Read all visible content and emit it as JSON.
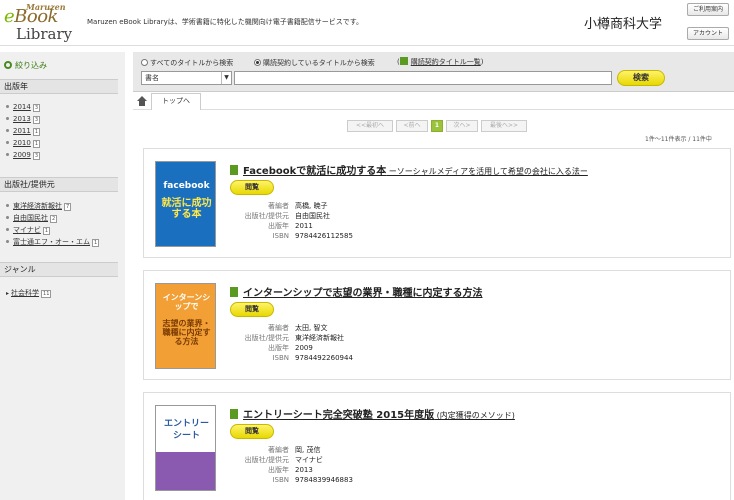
{
  "header": {
    "logo_line1": "Maruzen",
    "logo_line2_e": "e",
    "logo_line2_book": "Book",
    "logo_line3": "Library",
    "tagline": "Maruzen eBook Libraryは、学術書籍に特化した機関向け電子書籍配信サービスです。",
    "university": "小樽商科大学",
    "btn_guide": "ご利用案内",
    "btn_account": "アカウント"
  },
  "sidebar": {
    "filter_label": "絞り込み",
    "sections": [
      {
        "title": "出版年",
        "items": [
          {
            "label": "2014",
            "count": "3"
          },
          {
            "label": "2013",
            "count": "3"
          },
          {
            "label": "2011",
            "count": "1"
          },
          {
            "label": "2010",
            "count": "1"
          },
          {
            "label": "2009",
            "count": "3"
          }
        ]
      },
      {
        "title": "出版社/提供元",
        "items": [
          {
            "label": "東洋経済新報社",
            "count": "7"
          },
          {
            "label": "自由国民社",
            "count": "2"
          },
          {
            "label": "マイナビ",
            "count": "1"
          },
          {
            "label": "富士通エフ・オー・エム",
            "count": "1"
          }
        ]
      },
      {
        "title": "ジャンル",
        "items": [
          {
            "label": "社会科学",
            "count": "11"
          }
        ]
      }
    ]
  },
  "search": {
    "radio_all": "すべてのタイトルから検索",
    "radio_contracted": "購読契約しているタイトルから検索",
    "contract_list_link": "購読契約タイトル一覧",
    "field_select": "書名",
    "query": "",
    "submit": "検索"
  },
  "breadcrumb": {
    "top": "トップへ"
  },
  "pagination": {
    "first": "<<最初へ",
    "prev": "<前へ",
    "current": "1",
    "next": "次へ>",
    "last": "最後へ>>",
    "count_text": "1件〜11件表示 / 11件中"
  },
  "meta_labels": {
    "author": "著編者",
    "publisher": "出版社/提供元",
    "year": "出版年",
    "isbn": "ISBN"
  },
  "read_label": "閲覧",
  "books": [
    {
      "title": "Facebookで就活に成功する本",
      "subtitle": " ーソーシャルメディアを活用して希望の会社に入る法ー",
      "author": "高橋, 暁子",
      "publisher": "自由国民社",
      "year": "2011",
      "isbn": "9784426112585",
      "cover_text_top": "facebook",
      "cover_text_main": "就活に成功する本"
    },
    {
      "title": "インターンシップで志望の業界・職種に内定する方法",
      "subtitle": "",
      "author": "太田, 智文",
      "publisher": "東洋経済新報社",
      "year": "2009",
      "isbn": "9784492260944",
      "cover_text_top": "インターンシップで",
      "cover_text_main": "志望の業界・職種に内定する方法"
    },
    {
      "title": "エントリーシート完全突破塾 2015年度版",
      "subtitle": " (内定獲得のメソッド)",
      "author": "岡, 茂信",
      "publisher": "マイナビ",
      "year": "2013",
      "isbn": "9784839946883",
      "cover_text_top": "エントリー",
      "cover_text_main": "シート"
    }
  ],
  "colors": {
    "accent_green": "#5a9a20",
    "button_yellow": "#e7d800",
    "cover1": "#1a6fbf",
    "cover2": "#f2a036",
    "cover3": "#8a5ab0"
  }
}
